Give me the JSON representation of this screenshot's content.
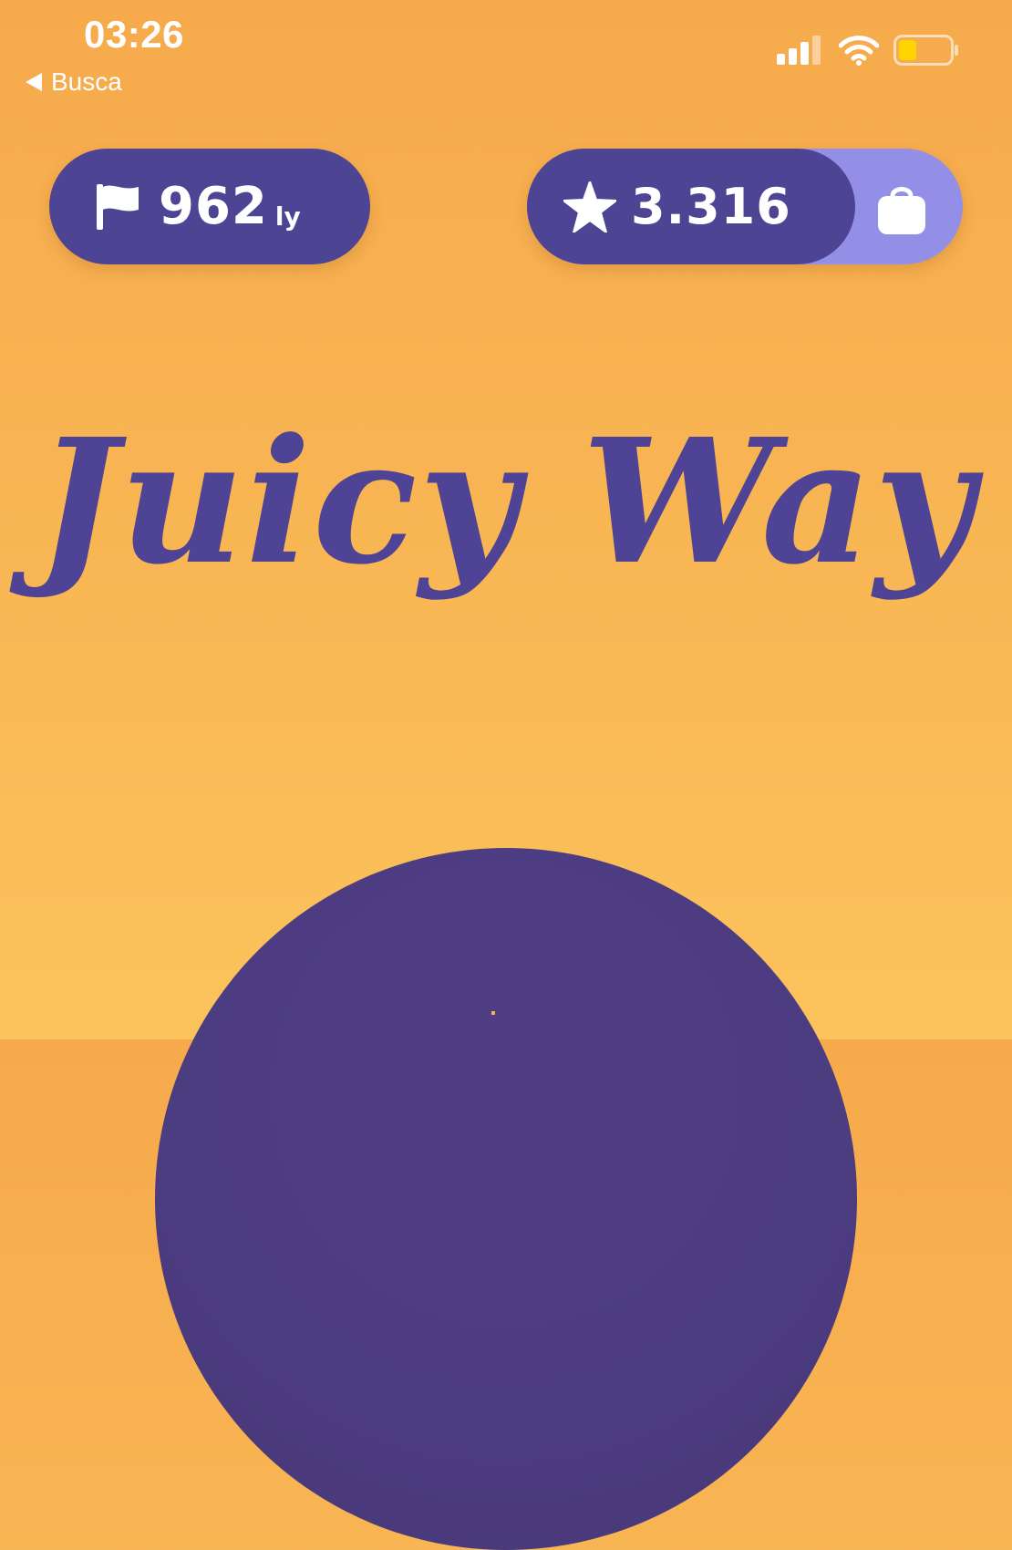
{
  "status_bar": {
    "time": "03:26",
    "back_label": "Busca",
    "battery_level": 0.35,
    "signal_bars": 3
  },
  "hud": {
    "distance_value": "962",
    "distance_unit": "ly",
    "stars_value": "3.316",
    "icons": [
      "flag-icon",
      "star-icon",
      "shopping-bag-icon"
    ]
  },
  "game": {
    "title": "Juicy Way"
  },
  "colors": {
    "background_top": "#f6aa4c",
    "background_bottom": "#fbc35c",
    "pill_dark": "#4d4493",
    "pill_light": "#948fe6",
    "title": "#4e4394",
    "planet": "#4c3c80",
    "battery": "#ffd400"
  }
}
